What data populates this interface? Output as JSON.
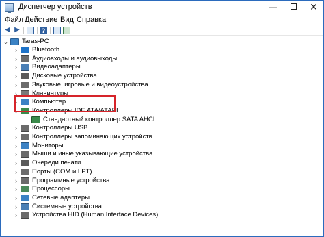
{
  "window": {
    "title": "Диспетчер устройств"
  },
  "menu": [
    "Файл",
    "Действие",
    "Вид",
    "Справка"
  ],
  "tree": {
    "root": "Taras-PC",
    "items": [
      {
        "label": "Bluetooth",
        "icon": "bluetooth-icon",
        "color": "#1e73c8"
      },
      {
        "label": "Аудиовходы и аудиовыходы",
        "icon": "audio-icon",
        "color": "#6b6b6b"
      },
      {
        "label": "Видеоадаптеры",
        "icon": "display-adapter-icon",
        "color": "#4a7fb5"
      },
      {
        "label": "Дисковые устройства",
        "icon": "disk-drive-icon",
        "color": "#5a5a5a"
      },
      {
        "label": "Звуковые, игровые и видеоустройства",
        "icon": "sound-icon",
        "color": "#6b6b6b"
      },
      {
        "label": "Клавиатуры",
        "icon": "keyboard-icon",
        "color": "#7a7a7a"
      },
      {
        "label": "Компьютер",
        "icon": "computer-icon",
        "color": "#3b82c4"
      },
      {
        "label": "Контроллеры IDE ATA/ATAPI",
        "icon": "ide-controller-icon",
        "color": "#3a8a4a"
      },
      {
        "label": "Стандартный контроллер SATA AHCI",
        "icon": "sata-controller-icon",
        "color": "#3a8a4a"
      },
      {
        "label": "Контроллеры USB",
        "icon": "usb-icon",
        "color": "#6b6b6b"
      },
      {
        "label": "Контроллеры запоминающих устройств",
        "icon": "storage-controller-icon",
        "color": "#6b6b6b"
      },
      {
        "label": "Мониторы",
        "icon": "monitor-icon",
        "color": "#3b82c4"
      },
      {
        "label": "Мыши и иные указывающие устройства",
        "icon": "mouse-icon",
        "color": "#6b6b6b"
      },
      {
        "label": "Очереди печати",
        "icon": "printer-icon",
        "color": "#5a5a5a"
      },
      {
        "label": "Порты (COM и LPT)",
        "icon": "port-icon",
        "color": "#6b6b6b"
      },
      {
        "label": "Программные устройства",
        "icon": "software-device-icon",
        "color": "#6b6b6b"
      },
      {
        "label": "Процессоры",
        "icon": "processor-icon",
        "color": "#4a8a5a"
      },
      {
        "label": "Сетевые адаптеры",
        "icon": "network-adapter-icon",
        "color": "#3b82c4"
      },
      {
        "label": "Системные устройства",
        "icon": "system-device-icon",
        "color": "#4a7fb5"
      },
      {
        "label": "Устройства HID (Human Interface Devices)",
        "icon": "hid-icon",
        "color": "#6b6b6b"
      }
    ]
  },
  "highlight_color": "#d6242a"
}
